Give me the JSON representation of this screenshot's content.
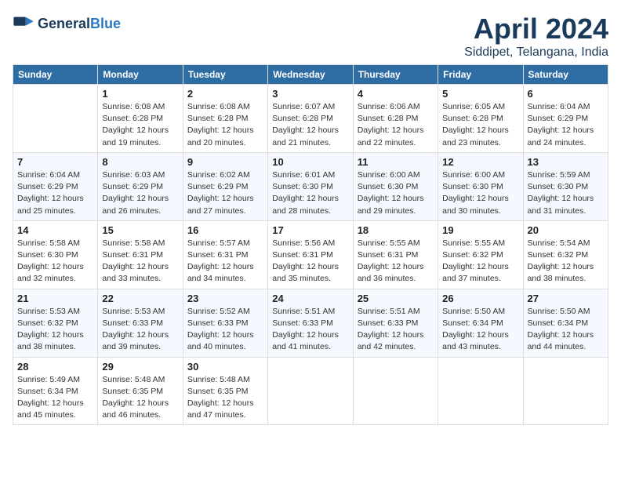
{
  "header": {
    "logo_general": "General",
    "logo_blue": "Blue",
    "title": "April 2024",
    "subtitle": "Siddipet, Telangana, India"
  },
  "columns": [
    "Sunday",
    "Monday",
    "Tuesday",
    "Wednesday",
    "Thursday",
    "Friday",
    "Saturday"
  ],
  "weeks": [
    [
      {
        "day": "",
        "info": ""
      },
      {
        "day": "1",
        "info": "Sunrise: 6:08 AM\nSunset: 6:28 PM\nDaylight: 12 hours\nand 19 minutes."
      },
      {
        "day": "2",
        "info": "Sunrise: 6:08 AM\nSunset: 6:28 PM\nDaylight: 12 hours\nand 20 minutes."
      },
      {
        "day": "3",
        "info": "Sunrise: 6:07 AM\nSunset: 6:28 PM\nDaylight: 12 hours\nand 21 minutes."
      },
      {
        "day": "4",
        "info": "Sunrise: 6:06 AM\nSunset: 6:28 PM\nDaylight: 12 hours\nand 22 minutes."
      },
      {
        "day": "5",
        "info": "Sunrise: 6:05 AM\nSunset: 6:28 PM\nDaylight: 12 hours\nand 23 minutes."
      },
      {
        "day": "6",
        "info": "Sunrise: 6:04 AM\nSunset: 6:29 PM\nDaylight: 12 hours\nand 24 minutes."
      }
    ],
    [
      {
        "day": "7",
        "info": "Sunrise: 6:04 AM\nSunset: 6:29 PM\nDaylight: 12 hours\nand 25 minutes."
      },
      {
        "day": "8",
        "info": "Sunrise: 6:03 AM\nSunset: 6:29 PM\nDaylight: 12 hours\nand 26 minutes."
      },
      {
        "day": "9",
        "info": "Sunrise: 6:02 AM\nSunset: 6:29 PM\nDaylight: 12 hours\nand 27 minutes."
      },
      {
        "day": "10",
        "info": "Sunrise: 6:01 AM\nSunset: 6:30 PM\nDaylight: 12 hours\nand 28 minutes."
      },
      {
        "day": "11",
        "info": "Sunrise: 6:00 AM\nSunset: 6:30 PM\nDaylight: 12 hours\nand 29 minutes."
      },
      {
        "day": "12",
        "info": "Sunrise: 6:00 AM\nSunset: 6:30 PM\nDaylight: 12 hours\nand 30 minutes."
      },
      {
        "day": "13",
        "info": "Sunrise: 5:59 AM\nSunset: 6:30 PM\nDaylight: 12 hours\nand 31 minutes."
      }
    ],
    [
      {
        "day": "14",
        "info": "Sunrise: 5:58 AM\nSunset: 6:30 PM\nDaylight: 12 hours\nand 32 minutes."
      },
      {
        "day": "15",
        "info": "Sunrise: 5:58 AM\nSunset: 6:31 PM\nDaylight: 12 hours\nand 33 minutes."
      },
      {
        "day": "16",
        "info": "Sunrise: 5:57 AM\nSunset: 6:31 PM\nDaylight: 12 hours\nand 34 minutes."
      },
      {
        "day": "17",
        "info": "Sunrise: 5:56 AM\nSunset: 6:31 PM\nDaylight: 12 hours\nand 35 minutes."
      },
      {
        "day": "18",
        "info": "Sunrise: 5:55 AM\nSunset: 6:31 PM\nDaylight: 12 hours\nand 36 minutes."
      },
      {
        "day": "19",
        "info": "Sunrise: 5:55 AM\nSunset: 6:32 PM\nDaylight: 12 hours\nand 37 minutes."
      },
      {
        "day": "20",
        "info": "Sunrise: 5:54 AM\nSunset: 6:32 PM\nDaylight: 12 hours\nand 38 minutes."
      }
    ],
    [
      {
        "day": "21",
        "info": "Sunrise: 5:53 AM\nSunset: 6:32 PM\nDaylight: 12 hours\nand 38 minutes."
      },
      {
        "day": "22",
        "info": "Sunrise: 5:53 AM\nSunset: 6:33 PM\nDaylight: 12 hours\nand 39 minutes."
      },
      {
        "day": "23",
        "info": "Sunrise: 5:52 AM\nSunset: 6:33 PM\nDaylight: 12 hours\nand 40 minutes."
      },
      {
        "day": "24",
        "info": "Sunrise: 5:51 AM\nSunset: 6:33 PM\nDaylight: 12 hours\nand 41 minutes."
      },
      {
        "day": "25",
        "info": "Sunrise: 5:51 AM\nSunset: 6:33 PM\nDaylight: 12 hours\nand 42 minutes."
      },
      {
        "day": "26",
        "info": "Sunrise: 5:50 AM\nSunset: 6:34 PM\nDaylight: 12 hours\nand 43 minutes."
      },
      {
        "day": "27",
        "info": "Sunrise: 5:50 AM\nSunset: 6:34 PM\nDaylight: 12 hours\nand 44 minutes."
      }
    ],
    [
      {
        "day": "28",
        "info": "Sunrise: 5:49 AM\nSunset: 6:34 PM\nDaylight: 12 hours\nand 45 minutes."
      },
      {
        "day": "29",
        "info": "Sunrise: 5:48 AM\nSunset: 6:35 PM\nDaylight: 12 hours\nand 46 minutes."
      },
      {
        "day": "30",
        "info": "Sunrise: 5:48 AM\nSunset: 6:35 PM\nDaylight: 12 hours\nand 47 minutes."
      },
      {
        "day": "",
        "info": ""
      },
      {
        "day": "",
        "info": ""
      },
      {
        "day": "",
        "info": ""
      },
      {
        "day": "",
        "info": ""
      }
    ]
  ]
}
